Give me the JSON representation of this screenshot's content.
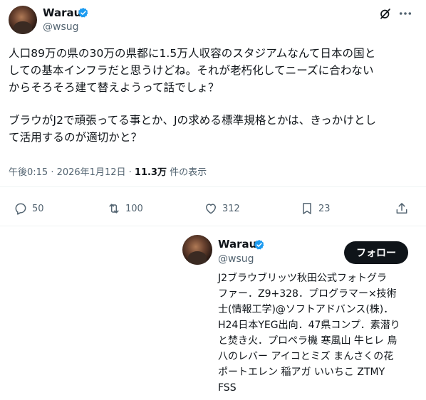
{
  "tweet": {
    "author_name": "Warau",
    "author_handle": "@wsug",
    "verified": true,
    "paragraphs": [
      "人口89万の県の30万の県都に1.5万人収容のスタジアムなんて日本の国と\nしての基本インフラだと思うけどね。それが老朽化してニーズに合わない\nからそろそろ建て替えようって話でしょ？",
      "ブラウがJ2で頑張ってる事とか、Jの求める標準規格とかは、きっかけとし\nて活用するのが適切かと？"
    ],
    "time": "午後0:15 · 2026年1月12日 ·",
    "views_count": "11.3万",
    "views_label": "件の表示"
  },
  "actions": {
    "replies": "50",
    "retweets": "100",
    "likes": "312",
    "bookmarks": "23"
  },
  "hover_card": {
    "name": "Warau",
    "handle": "@wsug",
    "follow_label": "フォロー",
    "bio": "J2ブラウブリッツ秋田公式フォトグラ\nファー．Z9+328．プログラマー×技術\n士(情報工学)@ソフトアドバンス(株)．\nH24日本YEG出向．47県コンプ．素潜り\nと焚き火．プロペラ機 寒風山 牛ヒレ 鳥\n八のレバー アイコとミズ まんさくの花\nポートエレン 稲アガ いいちこ ZTMY\nFSS"
  },
  "colors": {
    "verified_blue": "#1d9bf0",
    "text_primary": "#0f1419",
    "text_secondary": "#536471",
    "divider": "#eff3f4",
    "follow_button_bg": "#0f1419"
  },
  "icons": [
    "verified-badge-icon",
    "grok-icon",
    "more-icon",
    "reply-icon",
    "retweet-icon",
    "like-icon",
    "bookmark-icon",
    "share-icon"
  ]
}
